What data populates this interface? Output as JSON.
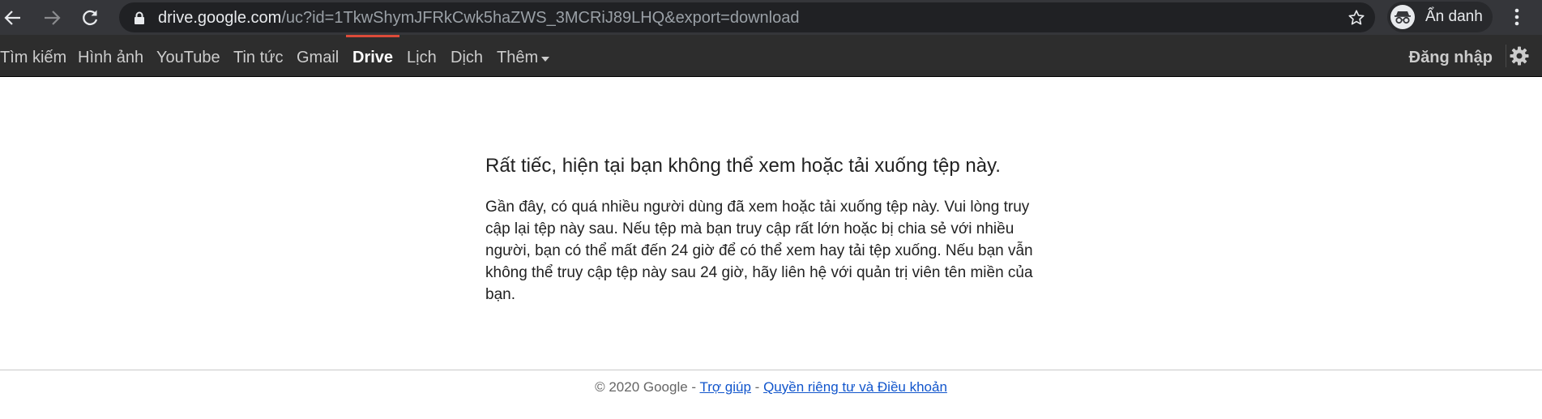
{
  "browser": {
    "url_host": "drive.google.com",
    "url_path": "/uc?id=1TkwShymJFRkCwk5haZWS_3MCRiJ89LHQ&export=download",
    "incognito_label": "Ẩn danh",
    "icons": {
      "back": "arrow-left-icon",
      "forward": "arrow-right-icon",
      "reload": "reload-icon",
      "lock": "lock-icon",
      "bookmark": "star-icon",
      "incognito": "incognito-icon",
      "menu": "three-dots-vertical-icon"
    }
  },
  "gbar": {
    "links": [
      "Tìm kiếm",
      "Hình ảnh",
      "YouTube",
      "Tin tức",
      "Gmail",
      "Drive",
      "Lịch",
      "Dịch",
      "Thêm"
    ],
    "active": "Drive",
    "signin_label": "Đăng nhập",
    "colors": {
      "background": "#2d2d2d",
      "active_indicator": "#dd4b39"
    }
  },
  "main": {
    "title": "Rất tiếc, hiện tại bạn không thể xem hoặc tải xuống tệp này.",
    "body": "Gần đây, có quá nhiều người dùng đã xem hoặc tải xuống tệp này. Vui lòng truy cập lại tệp này sau. Nếu tệp mà bạn truy cập rất lớn hoặc bị chia sẻ với nhiều người, bạn có thể mất đến 24 giờ để có thể xem hay tải tệp xuống. Nếu bạn vẫn không thể truy cập tệp này sau 24 giờ, hãy liên hệ với quản trị viên tên miền của bạn."
  },
  "footer": {
    "copyright": "© 2020 Google",
    "separator": " - ",
    "help_link": "Trợ giúp",
    "privacy_link": "Quyền riêng tư và Điều khoản",
    "link_color": "#1155cc"
  }
}
